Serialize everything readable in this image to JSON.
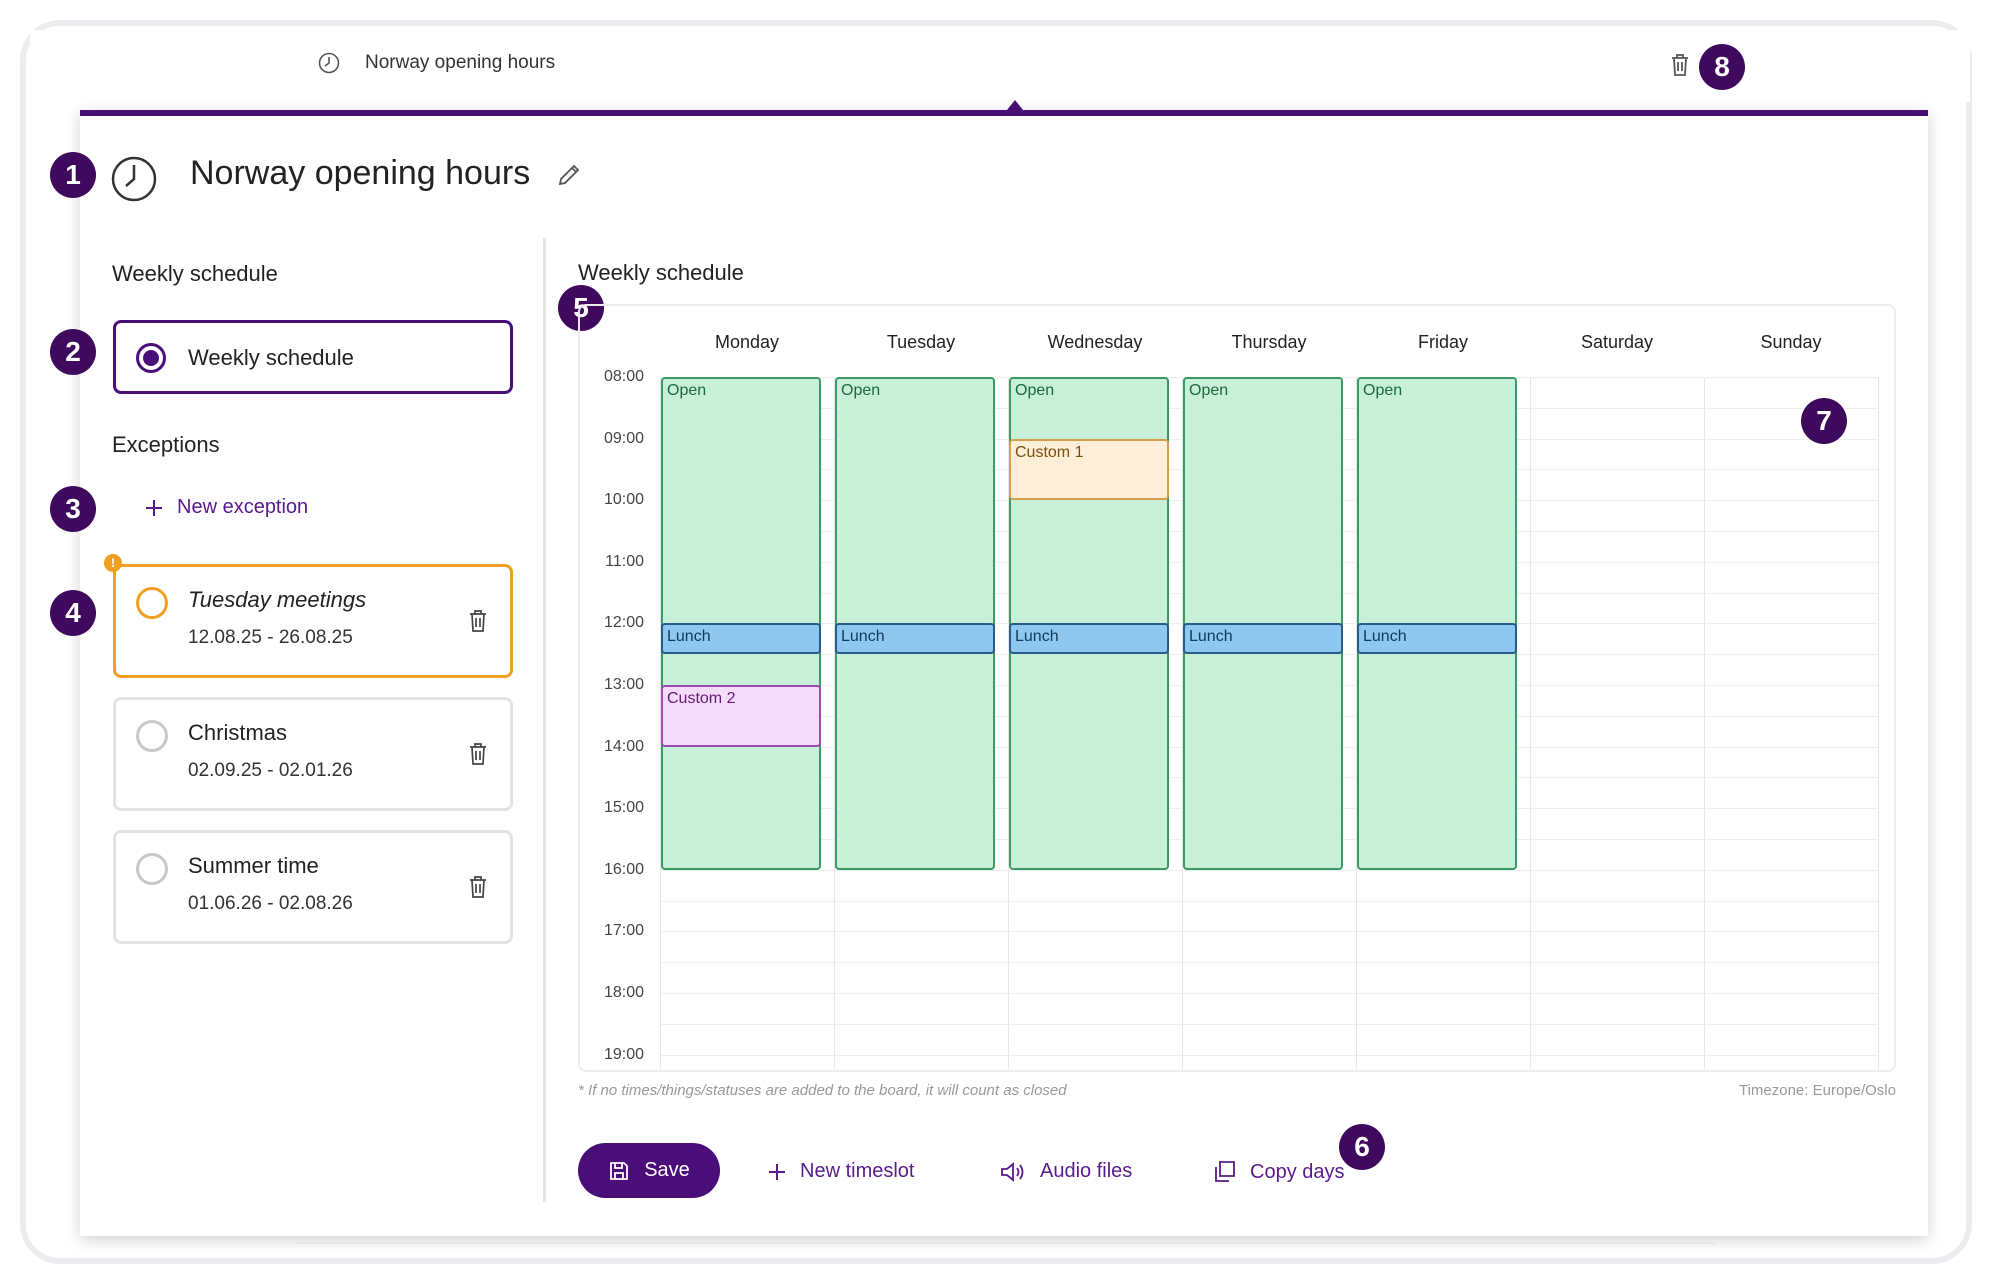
{
  "topbar": {
    "title": "Norway opening hours"
  },
  "header": {
    "title": "Norway opening hours"
  },
  "sidebar": {
    "weekly_heading": "Weekly schedule",
    "weekly_option": "Weekly schedule",
    "exceptions_heading": "Exceptions",
    "new_exception": "New exception",
    "exceptions": [
      {
        "name": "Tuesday meetings",
        "dates": "12.08.25 - 26.08.25",
        "warning": true
      },
      {
        "name": "Christmas",
        "dates": "02.09.25 - 02.01.26",
        "warning": false
      },
      {
        "name": "Summer time",
        "dates": "01.06.26 - 02.08.26",
        "warning": false
      }
    ]
  },
  "schedule": {
    "heading": "Weekly schedule",
    "days": [
      "Monday",
      "Tuesday",
      "Wednesday",
      "Thursday",
      "Friday",
      "Saturday",
      "Sunday"
    ],
    "times": [
      "08:00",
      "09:00",
      "10:00",
      "11:00",
      "12:00",
      "13:00",
      "14:00",
      "15:00",
      "16:00",
      "17:00",
      "18:00",
      "19:00"
    ],
    "slots": [
      {
        "day": 0,
        "start": 8,
        "end": 16,
        "label": "Open",
        "kind": "open"
      },
      {
        "day": 1,
        "start": 8,
        "end": 16,
        "label": "Open",
        "kind": "open"
      },
      {
        "day": 2,
        "start": 8,
        "end": 16,
        "label": "Open",
        "kind": "open"
      },
      {
        "day": 3,
        "start": 8,
        "end": 16,
        "label": "Open",
        "kind": "open"
      },
      {
        "day": 4,
        "start": 8,
        "end": 16,
        "label": "Open",
        "kind": "open"
      },
      {
        "day": 2,
        "start": 9,
        "end": 10,
        "label": "Custom 1",
        "kind": "custom1"
      },
      {
        "day": 0,
        "start": 12,
        "end": 12.5,
        "label": "Lunch",
        "kind": "lunch"
      },
      {
        "day": 1,
        "start": 12,
        "end": 12.5,
        "label": "Lunch",
        "kind": "lunch"
      },
      {
        "day": 2,
        "start": 12,
        "end": 12.5,
        "label": "Lunch",
        "kind": "lunch"
      },
      {
        "day": 3,
        "start": 12,
        "end": 12.5,
        "label": "Lunch",
        "kind": "lunch"
      },
      {
        "day": 4,
        "start": 12,
        "end": 12.5,
        "label": "Lunch",
        "kind": "lunch"
      },
      {
        "day": 0,
        "start": 13,
        "end": 14,
        "label": "Custom 2",
        "kind": "custom2"
      }
    ],
    "note": "* If no times/things/statuses are added to the board, it will count as closed",
    "timezone": "Timezone: Europe/Oslo"
  },
  "actions": {
    "save": "Save",
    "new_timeslot": "New timeslot",
    "audio_files": "Audio files",
    "copy_days": "Copy days"
  },
  "badges": [
    "1",
    "2",
    "3",
    "4",
    "5",
    "6",
    "7",
    "8"
  ],
  "colors": {
    "primary": "#4a0e78",
    "badge": "#3f0a5e",
    "warning": "#f0a020",
    "open": "#c8efd8",
    "lunch": "#8ec8f0",
    "custom1": "#fdeed8",
    "custom2": "#f4dcfa"
  }
}
